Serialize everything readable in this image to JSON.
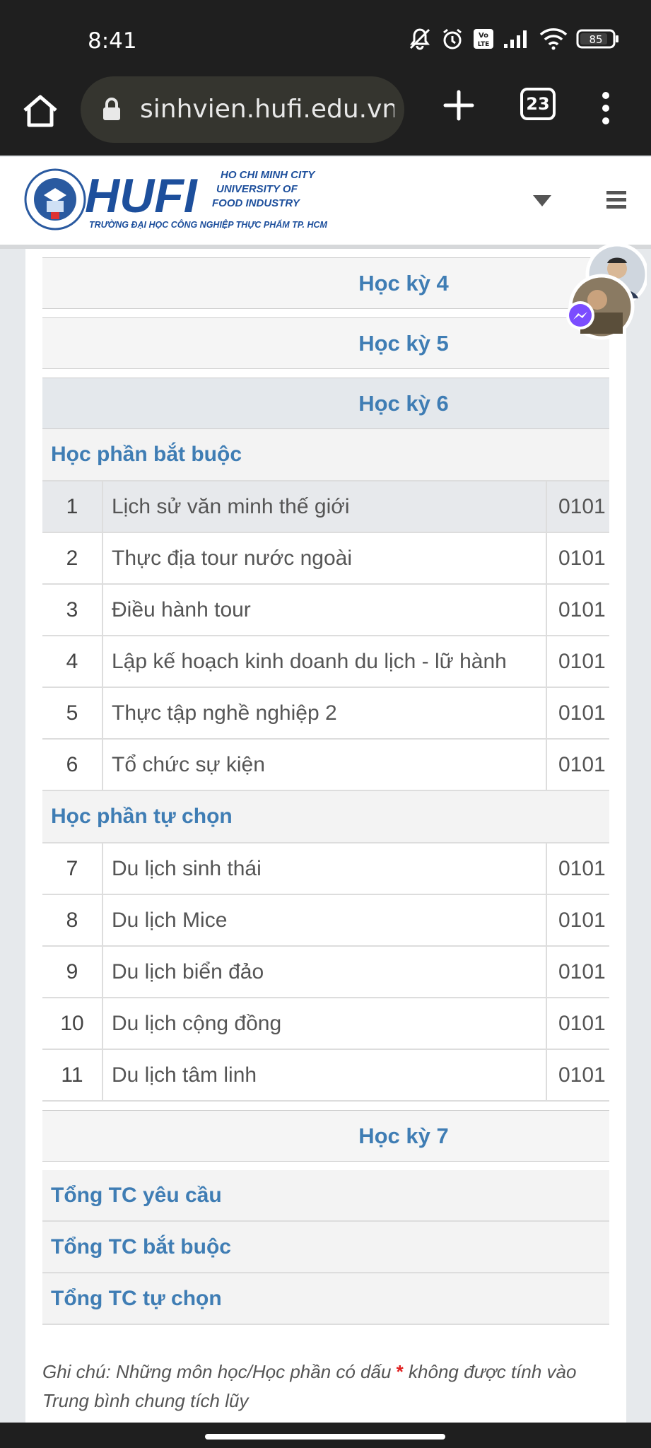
{
  "status_bar": {
    "time": "8:41",
    "battery": "85",
    "volte": "Vo LTE",
    "icons": [
      "mute-icon",
      "alarm-icon",
      "volte-icon",
      "signal-icon",
      "wifi-icon",
      "battery-icon"
    ]
  },
  "browser": {
    "url": "sinhvien.hufi.edu.vn/c",
    "tab_count": "23",
    "icons": [
      "home-icon",
      "lock-icon",
      "new-tab-icon",
      "tabs-icon",
      "more-options-icon"
    ]
  },
  "site": {
    "logo_text": {
      "acronym": "HUFI",
      "line1": "HO CHI MINH CITY",
      "line2": "UNIVERSITY OF",
      "line3": "FOOD INDUSTRY",
      "subtitle": "TRƯỜNG ĐẠI HỌC CÔNG NGHIỆP THỰC PHẨM TP. HCM"
    },
    "icons": [
      "dropdown-caret-icon",
      "hamburger-menu-icon"
    ]
  },
  "curriculum": {
    "semesters_before": [
      {
        "label": "Học kỳ 4"
      },
      {
        "label": "Học kỳ 5"
      }
    ],
    "active_semester": {
      "label": "Học kỳ 6",
      "groups": [
        {
          "label": "Học phần bắt buộc",
          "courses": [
            {
              "no": "1",
              "name": "Lịch sử văn minh thế giới",
              "code": "0101"
            },
            {
              "no": "2",
              "name": "Thực địa tour nước ngoài",
              "code": "0101"
            },
            {
              "no": "3",
              "name": "Điều hành tour",
              "code": "0101"
            },
            {
              "no": "4",
              "name": "Lập kế hoạch kinh doanh du lịch - lữ hành",
              "code": "0101"
            },
            {
              "no": "5",
              "name": "Thực tập nghề nghiệp 2",
              "code": "0101"
            },
            {
              "no": "6",
              "name": "Tổ chức sự kiện",
              "code": "0101"
            }
          ]
        },
        {
          "label": "Học phần tự chọn",
          "courses": [
            {
              "no": "7",
              "name": "Du lịch sinh thái",
              "code": "0101"
            },
            {
              "no": "8",
              "name": "Du lịch Mice",
              "code": "0101"
            },
            {
              "no": "9",
              "name": "Du lịch biển đảo",
              "code": "0101"
            },
            {
              "no": "10",
              "name": "Du lịch cộng đồng",
              "code": "0101"
            },
            {
              "no": "11",
              "name": "Du lịch tâm linh",
              "code": "0101"
            }
          ]
        }
      ]
    },
    "semesters_after": [
      {
        "label": "Học kỳ 7"
      }
    ],
    "totals": [
      {
        "label": "Tổng TC yêu cầu"
      },
      {
        "label": "Tổng TC bắt buộc"
      },
      {
        "label": "Tổng TC tự chọn"
      }
    ],
    "note": {
      "before": "Ghi chú: Những môn học/Học phần có dấu ",
      "star": "*",
      "after": " không được tính vào Trung bình chung tích lũy"
    }
  },
  "colors": {
    "accent": "#3f7db4",
    "required_star": "#e02020",
    "system_bar": "#1f1f1f"
  }
}
